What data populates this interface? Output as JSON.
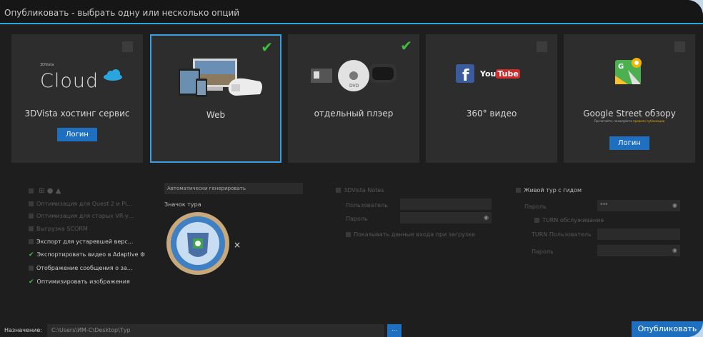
{
  "window": {
    "title": "Опубликовать - выбрать одну или несколько опций"
  },
  "cards": [
    {
      "small": "3DVista",
      "logo": "Cloud",
      "label": "3DVista хостинг сервис",
      "button": "Логин",
      "checked": false
    },
    {
      "label": "Web",
      "checked": true
    },
    {
      "label": "отдельный плэер",
      "checked": true
    },
    {
      "logo_text": "You",
      "logo_text2": "Tube",
      "label": "360° видео",
      "checked": false
    },
    {
      "label": "Google Street обзору",
      "note": "Прочитайте, пожалуйста",
      "note_link": "правила публикации",
      "button": "Логин",
      "checked": false
    }
  ],
  "options_left": [
    {
      "label": "Оптимизация для Quest 2 и Pi...",
      "checked": false
    },
    {
      "label": "Оптимизация для старых VR-у...",
      "checked": false
    },
    {
      "label": "Выгрузка SCORM",
      "checked": false
    },
    {
      "label": "Экспорт для устаревшей верс...",
      "checked": false
    },
    {
      "label": "Экспортировать видео в Adaptive",
      "checked": true
    },
    {
      "label": "Отображение сообщения о за...",
      "checked": false
    },
    {
      "label": "Оптимизировать изображения",
      "checked": true
    }
  ],
  "thumb": {
    "dropdown": "Автоматически генерировать",
    "label": "Значок тура",
    "remove": "×"
  },
  "notes": {
    "label": "3DVista Notes",
    "user_label": "Пользователь",
    "password_label": "Пароль",
    "show_data": "Показывать данные входа при загрузке"
  },
  "live": {
    "label": "Живой тур с гидом",
    "password_label": "Пароль",
    "password_value": "***",
    "turn_label": "TURN обслуживание",
    "turn_user": "TURN Пользователь",
    "turn_password": "Пароль"
  },
  "bottom": {
    "dest_label": "Назначение:",
    "path": "C:\\Users\\ИМ-С\\Desktop\\Тур",
    "browse": "...",
    "publish": "Опубликовать"
  }
}
